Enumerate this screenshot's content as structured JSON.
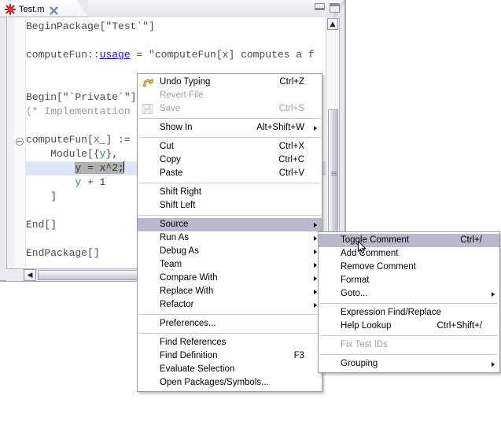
{
  "window": {
    "minimize_label": "Minimize",
    "maximize_label": "Maximize"
  },
  "tab": {
    "label": "Test.m",
    "icon": "mathematica-spikey-icon",
    "close_icon": "close-icon"
  },
  "editor": {
    "lines": [
      {
        "segments": [
          {
            "text": "BeginPackage[\"Test`\"]",
            "style": "plain"
          }
        ]
      },
      {
        "segments": []
      },
      {
        "segments": [
          {
            "text": "computeFun::",
            "style": "plain"
          },
          {
            "text": "usage",
            "style": "usage"
          },
          {
            "text": " = \"computeFun[x] computes a f",
            "style": "plain"
          }
        ]
      },
      {
        "segments": []
      },
      {
        "segments": []
      },
      {
        "segments": [
          {
            "text": "Begin[\"`Private`\"]",
            "style": "plain"
          }
        ]
      },
      {
        "segments": [
          {
            "text": "(* Implementation",
            "style": "comment"
          }
        ]
      },
      {
        "segments": []
      },
      {
        "segments": [
          {
            "text": "computeFun[",
            "style": "plain"
          },
          {
            "text": "x",
            "style": "var"
          },
          {
            "text": "_] :=",
            "style": "plain"
          }
        ]
      },
      {
        "segments": [
          {
            "text": "    Module[{",
            "style": "plain"
          },
          {
            "text": "y",
            "style": "var"
          },
          {
            "text": "},",
            "style": "plain"
          }
        ]
      },
      {
        "segments": [
          {
            "text": "        ",
            "style": "plain"
          },
          {
            "text": "y = x^2;",
            "style": "selected"
          }
        ],
        "highlighted": true
      },
      {
        "segments": [
          {
            "text": "        ",
            "style": "plain"
          },
          {
            "text": "y",
            "style": "var"
          },
          {
            "text": " + 1",
            "style": "plain"
          }
        ]
      },
      {
        "segments": [
          {
            "text": "    ]",
            "style": "plain"
          }
        ]
      },
      {
        "segments": []
      },
      {
        "segments": [
          {
            "text": "End[]",
            "style": "plain"
          }
        ]
      },
      {
        "segments": []
      },
      {
        "segments": [
          {
            "text": "EndPackage[]",
            "style": "plain"
          }
        ]
      }
    ]
  },
  "context_menu": {
    "items": [
      {
        "label": "Undo Typing",
        "accel": "Ctrl+Z",
        "icon": "undo-icon",
        "disabled": false,
        "submenu": false
      },
      {
        "label": "Revert File",
        "accel": "",
        "icon": "",
        "disabled": true,
        "submenu": false
      },
      {
        "label": "Save",
        "accel": "Ctrl+S",
        "icon": "save-icon",
        "disabled": true,
        "submenu": false
      },
      {
        "separator": true
      },
      {
        "label": "Show In",
        "accel": "Alt+Shift+W",
        "icon": "",
        "disabled": false,
        "submenu": true
      },
      {
        "separator": true
      },
      {
        "label": "Cut",
        "accel": "Ctrl+X",
        "icon": "",
        "disabled": false,
        "submenu": false
      },
      {
        "label": "Copy",
        "accel": "Ctrl+C",
        "icon": "",
        "disabled": false,
        "submenu": false
      },
      {
        "label": "Paste",
        "accel": "Ctrl+V",
        "icon": "",
        "disabled": false,
        "submenu": false
      },
      {
        "separator": true
      },
      {
        "label": "Shift Right",
        "accel": "",
        "icon": "",
        "disabled": false,
        "submenu": false
      },
      {
        "label": "Shift Left",
        "accel": "",
        "icon": "",
        "disabled": false,
        "submenu": false
      },
      {
        "separator": true
      },
      {
        "label": "Source",
        "accel": "",
        "icon": "",
        "disabled": false,
        "submenu": true,
        "highlighted": true
      },
      {
        "label": "Run As",
        "accel": "",
        "icon": "",
        "disabled": false,
        "submenu": true
      },
      {
        "label": "Debug As",
        "accel": "",
        "icon": "",
        "disabled": false,
        "submenu": true
      },
      {
        "label": "Team",
        "accel": "",
        "icon": "",
        "disabled": false,
        "submenu": true
      },
      {
        "label": "Compare With",
        "accel": "",
        "icon": "",
        "disabled": false,
        "submenu": true
      },
      {
        "label": "Replace With",
        "accel": "",
        "icon": "",
        "disabled": false,
        "submenu": true
      },
      {
        "label": "Refactor",
        "accel": "",
        "icon": "",
        "disabled": false,
        "submenu": true
      },
      {
        "separator": true
      },
      {
        "label": "Preferences...",
        "accel": "",
        "icon": "",
        "disabled": false,
        "submenu": false
      },
      {
        "separator": true
      },
      {
        "label": "Find References",
        "accel": "",
        "icon": "",
        "disabled": false,
        "submenu": false
      },
      {
        "label": "Find Definition",
        "accel": "F3",
        "icon": "",
        "disabled": false,
        "submenu": false
      },
      {
        "label": "Evaluate Selection",
        "accel": "",
        "icon": "",
        "disabled": false,
        "submenu": false
      },
      {
        "label": "Open Packages/Symbols...",
        "accel": "",
        "icon": "",
        "disabled": false,
        "submenu": false
      }
    ]
  },
  "source_submenu": {
    "items": [
      {
        "label": "Toggle Comment",
        "accel": "Ctrl+/",
        "disabled": false,
        "submenu": false,
        "highlighted": true
      },
      {
        "label": "Add Comment",
        "accel": "",
        "disabled": false,
        "submenu": false
      },
      {
        "label": "Remove Comment",
        "accel": "",
        "disabled": false,
        "submenu": false
      },
      {
        "label": "Format",
        "accel": "",
        "disabled": false,
        "submenu": false
      },
      {
        "label": "Goto...",
        "accel": "",
        "disabled": false,
        "submenu": true
      },
      {
        "separator": true
      },
      {
        "label": "Expression Find/Replace",
        "accel": "",
        "disabled": false,
        "submenu": false
      },
      {
        "label": "Help Lookup",
        "accel": "Ctrl+Shift+/",
        "disabled": false,
        "submenu": false
      },
      {
        "separator": true
      },
      {
        "label": "Fix Test IDs",
        "accel": "",
        "disabled": true,
        "submenu": false
      },
      {
        "separator": true
      },
      {
        "label": "Grouping",
        "accel": "",
        "disabled": false,
        "submenu": true
      }
    ]
  },
  "colors": {
    "menu_highlight": "#b9b9cc",
    "selection_line": "#dce6f4",
    "selection_text": "#b0b0b0",
    "usage_token": "#1414d2",
    "variable_token": "#2e8b57",
    "comment_token": "#9a9a9a"
  },
  "scrollbars": {
    "vertical_up_arrow": "scroll-up-icon",
    "horizontal_left_arrow": "scroll-left-icon"
  }
}
